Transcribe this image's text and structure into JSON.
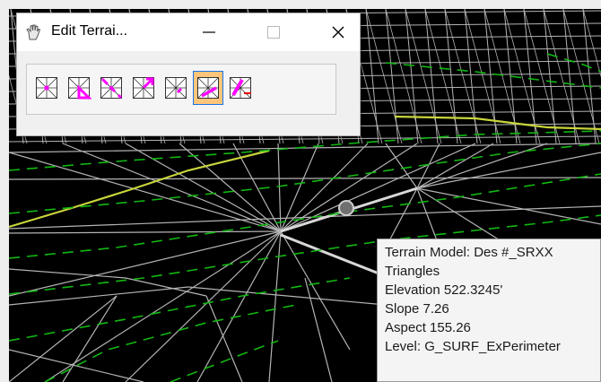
{
  "window": {
    "title": "Edit Terrai...",
    "title_icon": "hand-icon",
    "minimize_icon": "minimize-icon",
    "maximize_icon": "maximize-icon",
    "close_icon": "close-icon"
  },
  "tools": [
    {
      "icon": "tri-insert-point-icon",
      "active": false
    },
    {
      "icon": "tri-delete-point-icon",
      "active": false
    },
    {
      "icon": "tri-move-point-icon",
      "active": false
    },
    {
      "icon": "tri-flip-edge-icon",
      "active": false
    },
    {
      "icon": "tri-delete-edge-icon",
      "active": false
    },
    {
      "icon": "tri-edit-triangle-icon",
      "active": true
    },
    {
      "icon": "tri-delete-triangle-icon",
      "active": false
    }
  ],
  "colors": {
    "mesh": "#b4b4b4",
    "contour_major": "#c8d43c",
    "contour_minor": "#12b812",
    "tool_glyph": "#ff00ff",
    "tool_active_bg": "#ffc57a"
  },
  "tooltip": {
    "model": "Terrain Model: Des #_SRXX",
    "feature": "Triangles",
    "elevation": "Elevation 522.3245'",
    "slope": "Slope 7.26",
    "aspect": "Aspect 155.26",
    "level": "Level: G_SURF_ExPerimeter"
  }
}
